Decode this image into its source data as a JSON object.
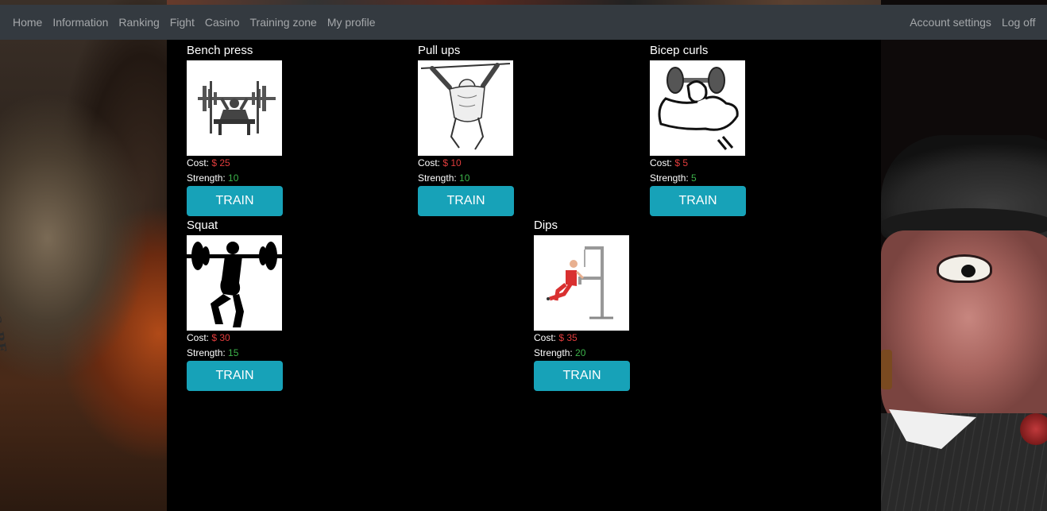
{
  "navbar": {
    "left_links": [
      "Home",
      "Information",
      "Ranking",
      "Fight",
      "Casino",
      "Training zone",
      "My profile"
    ],
    "right_links": [
      "Account settings",
      "Log off"
    ]
  },
  "background": {
    "coin_text": "UNITS PE"
  },
  "labels": {
    "cost": "Cost:",
    "strength": "Strength:",
    "train": "TRAIN"
  },
  "exercises": [
    {
      "name": "Bench press",
      "cost": "$ 25",
      "strength": "10",
      "icon": "bench-press-icon"
    },
    {
      "name": "Pull ups",
      "cost": "$ 10",
      "strength": "10",
      "icon": "pull-ups-icon"
    },
    {
      "name": "Bicep curls",
      "cost": "$ 5",
      "strength": "5",
      "icon": "bicep-curls-icon"
    },
    {
      "name": "Squat",
      "cost": "$ 30",
      "strength": "15",
      "icon": "squat-icon"
    },
    {
      "name": "Dips",
      "cost": "$ 35",
      "strength": "20",
      "icon": "dips-icon"
    }
  ],
  "colors": {
    "navbar_bg": "#343a40",
    "button_bg": "#17a2b8",
    "cost_color": "#e03c3c",
    "strength_color": "#3cb34a"
  }
}
